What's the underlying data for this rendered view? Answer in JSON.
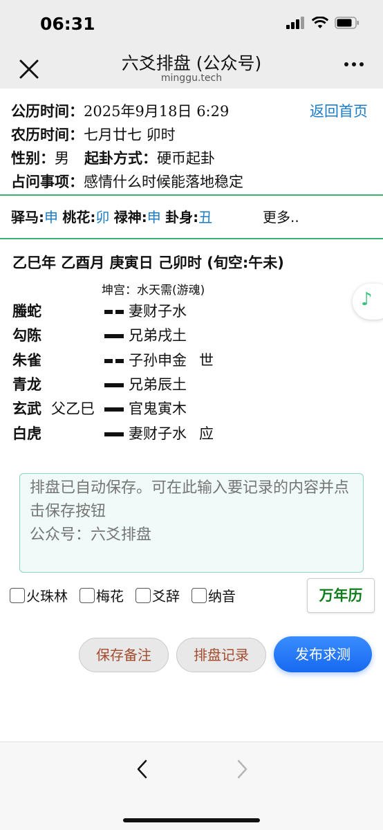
{
  "status": {
    "time": "06:31"
  },
  "nav": {
    "title": "六爻排盘 (公众号)",
    "subtitle": "minggu.tech"
  },
  "info": {
    "solar_label": "公历时间：",
    "solar_value": "2025年9月18日 6:29",
    "home_link": "返回首页",
    "lunar_label": "农历时间：",
    "lunar_value": "七月廿七 卯时",
    "gender_label": "性别：",
    "gender_value": "男",
    "method_label": "起卦方式：",
    "method_value": "硬币起卦",
    "question_label": "占问事项：",
    "question_value": "感情什么时候能落地稳定"
  },
  "spirits": {
    "yima_label": "驿马:",
    "yima_value": "申",
    "taohua_label": "桃花:",
    "taohua_value": "卯",
    "lushen_label": "禄神:",
    "lushen_value": "申",
    "guashen_label": "卦身:",
    "guashen_value": "丑",
    "more": "更多.."
  },
  "pillars": "乙巳年 乙酉月 庚寅日 己卯时 (旬空:午未)",
  "gong": "坤宫：水天需(游魂)",
  "yao": [
    {
      "god": "螣蛇",
      "hidden": "",
      "type": "yin",
      "text": "妻财子水",
      "mark": ""
    },
    {
      "god": "勾陈",
      "hidden": "",
      "type": "yang",
      "text": "兄弟戌土",
      "mark": ""
    },
    {
      "god": "朱雀",
      "hidden": "",
      "type": "yin",
      "text": "子孙申金",
      "mark": "世"
    },
    {
      "god": "青龙",
      "hidden": "",
      "type": "yang",
      "text": "兄弟辰土",
      "mark": ""
    },
    {
      "god": "玄武",
      "hidden": "父乙巳",
      "type": "yang",
      "text": "官鬼寅木",
      "mark": ""
    },
    {
      "god": "白虎",
      "hidden": "",
      "type": "yang",
      "text": "妻财子水",
      "mark": "应"
    }
  ],
  "music_icon": "music-note-icon",
  "notes": {
    "placeholder": "排盘已自动保存。可在此输入要记录的内容并点击保存按钮\n公众号：六爻排盘"
  },
  "checks": [
    "火珠林",
    "梅花",
    "爻辞",
    "纳音"
  ],
  "calendar_button": "万年历",
  "buttons": {
    "save": "保存备注",
    "records": "排盘记录",
    "publish": "发布求测"
  },
  "colors": {
    "accent_blue": "#1a7cc8",
    "divider_green": "#3bb06a",
    "calendar_green": "#0e7e1a",
    "primary_button": "#1769f0"
  }
}
